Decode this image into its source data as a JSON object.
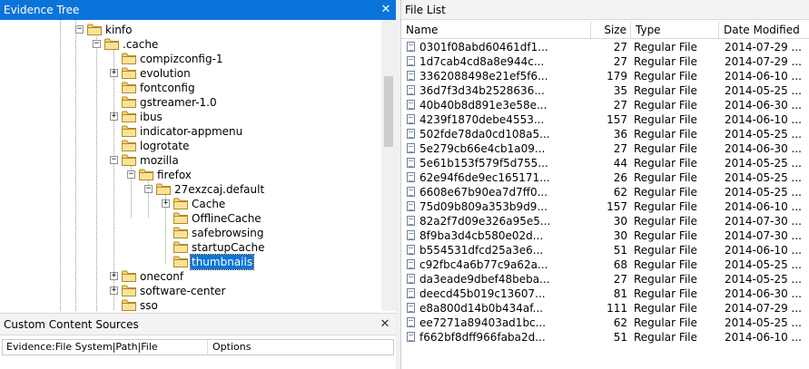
{
  "tree_panel": {
    "title": "Evidence Tree",
    "close": "✕",
    "nodes": [
      {
        "label": "kinfo",
        "expander": "−"
      },
      {
        "label": ".cache",
        "expander": "−"
      },
      {
        "label": "compizconfig-1",
        "expander": ""
      },
      {
        "label": "evolution",
        "expander": "+"
      },
      {
        "label": "fontconfig",
        "expander": ""
      },
      {
        "label": "gstreamer-1.0",
        "expander": ""
      },
      {
        "label": "ibus",
        "expander": "+"
      },
      {
        "label": "indicator-appmenu",
        "expander": ""
      },
      {
        "label": "logrotate",
        "expander": ""
      },
      {
        "label": "mozilla",
        "expander": "−"
      },
      {
        "label": "firefox",
        "expander": "−"
      },
      {
        "label": "27exzcaj.default",
        "expander": "−"
      },
      {
        "label": "Cache",
        "expander": "+"
      },
      {
        "label": "OfflineCache",
        "expander": ""
      },
      {
        "label": "safebrowsing",
        "expander": ""
      },
      {
        "label": "startupCache",
        "expander": ""
      },
      {
        "label": "thumbnails",
        "expander": "",
        "selected": true
      },
      {
        "label": "oneconf",
        "expander": "+"
      },
      {
        "label": "software-center",
        "expander": "+"
      },
      {
        "label": "sso",
        "expander": ""
      }
    ]
  },
  "ccs_panel": {
    "title": "Custom Content Sources",
    "close": "✕",
    "columns": [
      "Evidence:File System|Path|File",
      "Options"
    ]
  },
  "file_panel": {
    "title": "File List",
    "columns": [
      "Name",
      "Size",
      "Type",
      "Date Modified"
    ],
    "rows": [
      {
        "name": "0301f08abd60461df1...",
        "size": "27",
        "type": "Regular File",
        "date": "2014-07-29 ..."
      },
      {
        "name": "1d7cab4cd8a8e944c...",
        "size": "27",
        "type": "Regular File",
        "date": "2014-07-29 ..."
      },
      {
        "name": "3362088498e21ef5f6...",
        "size": "179",
        "type": "Regular File",
        "date": "2014-06-10 ..."
      },
      {
        "name": "36d7f3d34b2528636...",
        "size": "35",
        "type": "Regular File",
        "date": "2014-05-25 ..."
      },
      {
        "name": "40b40b8d891e3e58e...",
        "size": "27",
        "type": "Regular File",
        "date": "2014-06-30 ..."
      },
      {
        "name": "4239f1870debe4553...",
        "size": "157",
        "type": "Regular File",
        "date": "2014-06-10 ..."
      },
      {
        "name": "502fde78da0cd108a5...",
        "size": "36",
        "type": "Regular File",
        "date": "2014-05-25 ..."
      },
      {
        "name": "5e279cb66e4cb1a09...",
        "size": "27",
        "type": "Regular File",
        "date": "2014-06-30 ..."
      },
      {
        "name": "5e61b153f579f5d755...",
        "size": "44",
        "type": "Regular File",
        "date": "2014-05-25 ..."
      },
      {
        "name": "62e94f6de9ec165171...",
        "size": "26",
        "type": "Regular File",
        "date": "2014-05-25 ..."
      },
      {
        "name": "6608e67b90ea7d7ff0...",
        "size": "62",
        "type": "Regular File",
        "date": "2014-05-25 ..."
      },
      {
        "name": "75d09b809a353b9d9...",
        "size": "157",
        "type": "Regular File",
        "date": "2014-06-10 ..."
      },
      {
        "name": "82a2f7d09e326a95e5...",
        "size": "30",
        "type": "Regular File",
        "date": "2014-07-30 ..."
      },
      {
        "name": "8f9ba3d4cb580e02d...",
        "size": "30",
        "type": "Regular File",
        "date": "2014-07-30 ..."
      },
      {
        "name": "b554531dfcd25a3e6...",
        "size": "51",
        "type": "Regular File",
        "date": "2014-06-10 ..."
      },
      {
        "name": "c92fbc4a6b77c9a62a...",
        "size": "68",
        "type": "Regular File",
        "date": "2014-05-25 ..."
      },
      {
        "name": "da3eade9dbef48beba...",
        "size": "27",
        "type": "Regular File",
        "date": "2014-05-25 ..."
      },
      {
        "name": "deecd45b019c13607...",
        "size": "81",
        "type": "Regular File",
        "date": "2014-06-30 ..."
      },
      {
        "name": "e8a800d14b0b434af...",
        "size": "111",
        "type": "Regular File",
        "date": "2014-07-29 ..."
      },
      {
        "name": "ee7271a89403ad1bc...",
        "size": "62",
        "type": "Regular File",
        "date": "2014-05-25 ..."
      },
      {
        "name": "f662bf8dff966faba2d...",
        "size": "51",
        "type": "Regular File",
        "date": "2014-06-10 ..."
      }
    ]
  }
}
